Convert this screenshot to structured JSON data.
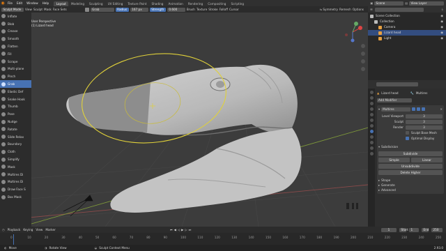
{
  "app": {
    "menus": [
      "File",
      "Edit",
      "Window",
      "Help"
    ],
    "workspace_tabs": [
      "Layout",
      "Modeling",
      "Sculpting",
      "UV Editing",
      "Texture Paint",
      "Shading",
      "Animation",
      "Rendering",
      "Compositing",
      "Scripting"
    ],
    "active_tab": "Layout",
    "scene_label": "Scene",
    "view_layer_label": "View Layer"
  },
  "header": {
    "mode": "Sculpt Mode",
    "menus": [
      "View",
      "Sculpt",
      "Mask",
      "Face Sets"
    ],
    "brush_name": "Grab",
    "radius_label": "Radius",
    "radius_value": "167 px",
    "strength_label": "Strength",
    "strength_value": "0.600",
    "options": [
      "Brush",
      "Texture",
      "Stroke",
      "Falloff",
      "Cursor"
    ],
    "right_items": [
      "Symmetry",
      "Remesh",
      "Options"
    ]
  },
  "viewport": {
    "view_label": "User Perspective",
    "object_label": "(1) Lizard head"
  },
  "tools": [
    "Inflate",
    "Blob",
    "Crease",
    "Smooth",
    "Flatten",
    "Fill",
    "Scrape",
    "Multi-plane",
    "Pinch",
    "Grab",
    "Elastic Def",
    "Snake Hook",
    "Thumb",
    "Pose",
    "Nudge",
    "Rotate",
    "Slide Relax",
    "Boundary",
    "Cloth",
    "Simplify",
    "Mask",
    "Multires Di",
    "Multires Di",
    "Draw Face S",
    "Box Mask"
  ],
  "active_tool_index": 9,
  "outliner": {
    "rows": [
      {
        "label": "Scene Collection",
        "indent": 0,
        "selected": false
      },
      {
        "label": "Collection",
        "indent": 1,
        "selected": false
      },
      {
        "label": "Camera",
        "indent": 2,
        "selected": false
      },
      {
        "label": "Lizard head",
        "indent": 2,
        "selected": true
      },
      {
        "label": "Light",
        "indent": 2,
        "selected": false
      }
    ]
  },
  "properties": {
    "object_name": "Lizard head",
    "modifier_tab": "Multires",
    "add_modifier": "Add Modifier",
    "modifier_name": "Multires",
    "fields": [
      {
        "label": "Level Viewport",
        "value": "3"
      },
      {
        "label": "Sculpt",
        "value": "3"
      },
      {
        "label": "Render",
        "value": "3"
      }
    ],
    "checkboxes": [
      {
        "label": "Sculpt Base Mesh",
        "checked": false
      },
      {
        "label": "Optimal Display",
        "checked": true
      }
    ],
    "subdivision_label": "Subdivision",
    "subdivide_btn": "Subdivide",
    "simple_btn": "Simple",
    "linear_btn": "Linear",
    "unsubdivide_btn": "Unsubdivide",
    "delete_higher_btn": "Delete Higher",
    "panels": [
      "Shape",
      "Generate",
      "Advanced"
    ]
  },
  "timeline": {
    "menus": [
      "Playback",
      "Keying",
      "View",
      "Marker"
    ],
    "current_frame": "1",
    "start_label": "Start",
    "start": "1",
    "end_label": "End",
    "end": "250",
    "ticks": [
      "0",
      "10",
      "20",
      "30",
      "40",
      "50",
      "60",
      "70",
      "80",
      "90",
      "100",
      "110",
      "120",
      "130",
      "140",
      "150",
      "160",
      "170",
      "180",
      "190",
      "200",
      "210",
      "220",
      "230",
      "240",
      "250"
    ]
  },
  "statusbar": {
    "items": [
      "Move",
      "Rotate View",
      "Sculpt Context Menu"
    ],
    "version": "2.93.0"
  },
  "colors": {
    "accent": "#4772b3",
    "brush_circle": "#e0d13a",
    "x_axis": "#8a4a4a",
    "y_axis": "#7f9a3a"
  }
}
